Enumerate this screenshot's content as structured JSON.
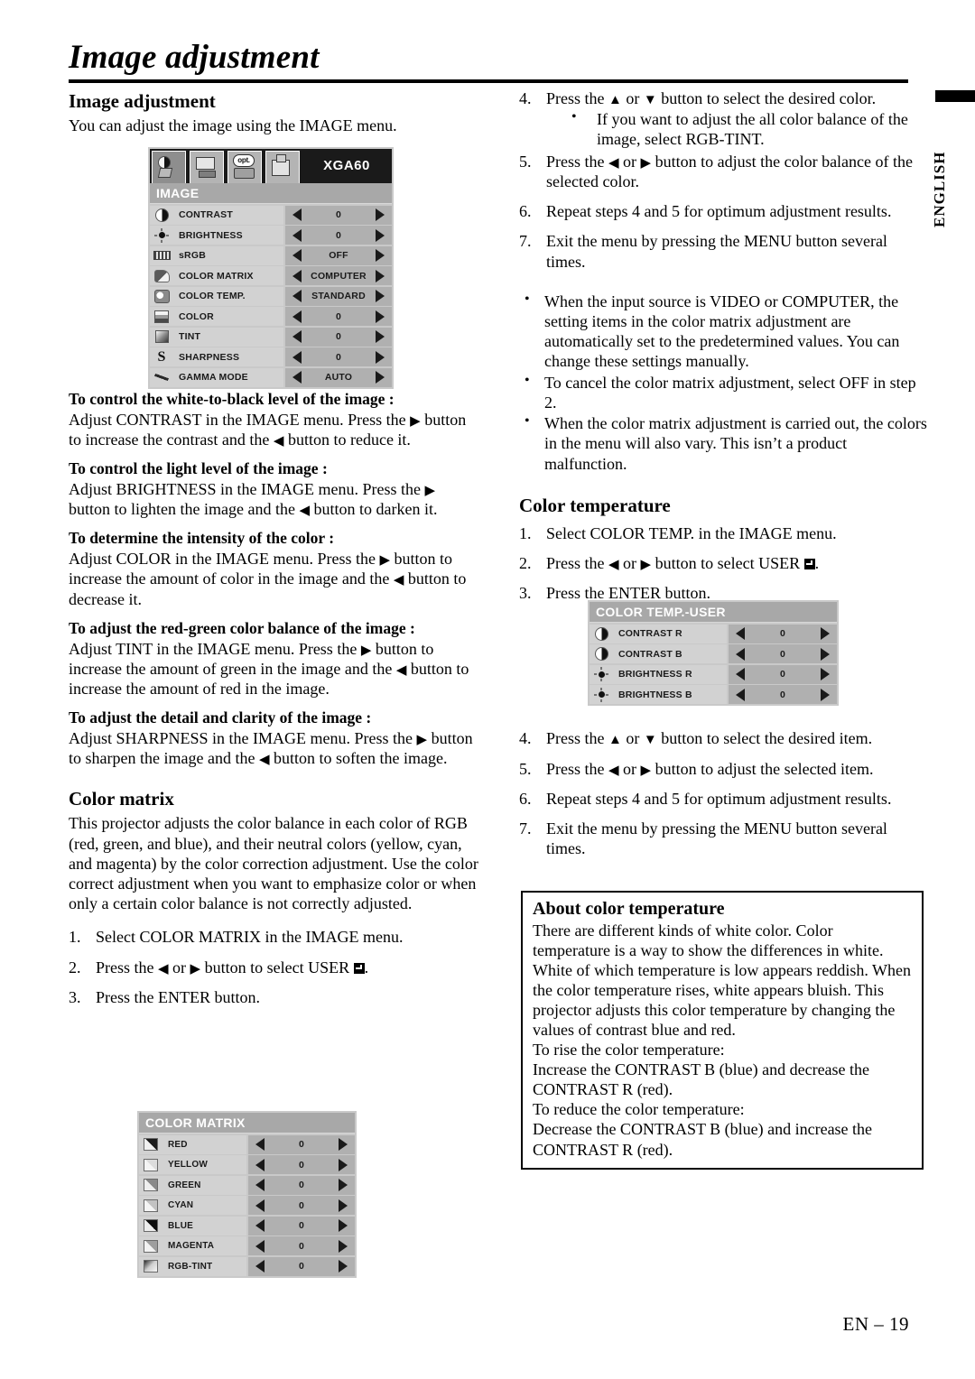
{
  "document": {
    "page_title": "Image adjustment",
    "side_tab_label": "ENGLISH",
    "footer": "EN – 19"
  },
  "left_column": {
    "section_heading": "Image adjustment",
    "intro": "You can adjust the image using the IMAGE menu.",
    "subsections": [
      {
        "heading": "To control the white-to-black level of the image :",
        "body_pre": "Adjust CONTRAST in the IMAGE menu.  Press the ",
        "body_mid": " button to increase the contrast and the ",
        "body_post": " button to reduce it."
      },
      {
        "heading": "To control the light level of the image :",
        "body_pre": "Adjust BRIGHTNESS in the IMAGE menu.  Press the ",
        "body_mid": " button to lighten the image and the ",
        "body_post": " button to darken it."
      },
      {
        "heading": "To determine the intensity of the color :",
        "body_pre": "Adjust COLOR in the IMAGE menu.  Press the ",
        "body_mid": " button to increase the amount of color in the image and the ",
        "body_post": " button to decrease it."
      },
      {
        "heading": "To adjust the red-green color balance of the image :",
        "body_pre": "Adjust TINT in the IMAGE menu.  Press the ",
        "body_mid": " button to increase the amount of green in the image and the ",
        "body_post": " button to increase the amount of red in the image."
      },
      {
        "heading": "To adjust the detail and clarity of the image :",
        "body_pre": "Adjust SHARPNESS in the IMAGE menu.  Press the ",
        "body_mid": " button to sharpen the image and the ",
        "body_post": " button to soften the image."
      }
    ],
    "color_matrix": {
      "heading": "Color matrix",
      "paragraph": "This projector adjusts the color balance in each color of RGB (red, green, and blue), and their neutral colors (yellow, cyan, and magenta) by the color correction adjustment. Use the color correct adjustment when you want to emphasize color or when only a certain color balance is not correctly adjusted.",
      "steps": [
        {
          "num": "1.",
          "pre": "Select COLOR MATRIX in the IMAGE menu.",
          "mid": "",
          "post": "",
          "has_arrows": false
        },
        {
          "num": "2.",
          "pre": "Press the ",
          "mid": " or ",
          "post": " button to select USER ",
          "has_arrows": true,
          "trailing": "."
        },
        {
          "num": "3.",
          "pre": "Press the ENTER button.",
          "mid": "",
          "post": "",
          "has_arrows": false
        }
      ]
    }
  },
  "right_column": {
    "color_matrix_steps": [
      {
        "num": "4.",
        "pre": "Press the ",
        "mid": " or ",
        "post": " button to select the desired color.",
        "arrows": "updown"
      },
      {
        "num": "5.",
        "pre": "Press the ",
        "mid": " or ",
        "post": " button to adjust the color balance of the selected color.",
        "arrows": "leftright"
      },
      {
        "num": "6.",
        "pre": "Repeat steps 4 and 5 for optimum adjustment results.",
        "mid": "",
        "post": "",
        "arrows": "none"
      },
      {
        "num": "7.",
        "pre": "Exit the menu by pressing the MENU button several times.",
        "mid": "",
        "post": "",
        "arrows": "none"
      }
    ],
    "color_matrix_substep": "If you want to adjust the all color balance of the image, select RGB-TINT.",
    "color_matrix_notes": [
      "When the input source is VIDEO or COMPUTER, the setting items in the color matrix adjustment are automatically set to the predetermined values. You can change these settings manually.",
      "To cancel the color matrix adjustment, select OFF in step 2.",
      "When the color matrix adjustment is carried out, the colors in the menu will also vary. This isn’t a product malfunction."
    ],
    "color_temperature": {
      "heading": "Color temperature",
      "steps_top": [
        {
          "num": "1.",
          "pre": "Select COLOR TEMP. in the IMAGE menu.",
          "mid": "",
          "post": "",
          "arrows": "none"
        },
        {
          "num": "2.",
          "pre": "Press the ",
          "mid": " or ",
          "post": " button to select USER ",
          "arrows": "leftright",
          "trailing": "."
        },
        {
          "num": "3.",
          "pre": "Press the ENTER button.",
          "mid": "",
          "post": "",
          "arrows": "none"
        }
      ],
      "steps_bottom": [
        {
          "num": "4.",
          "pre": "Press the ",
          "mid": " or ",
          "post": " button to select the desired item.",
          "arrows": "updown"
        },
        {
          "num": "5.",
          "pre": "Press the ",
          "mid": " or ",
          "post": " button to adjust the selected item.",
          "arrows": "leftright"
        },
        {
          "num": "6.",
          "pre": "Repeat steps 4 and 5 for optimum adjustment results.",
          "mid": "",
          "post": "",
          "arrows": "none"
        },
        {
          "num": "7.",
          "pre": "Exit the menu by pressing the MENU button several times.",
          "mid": "",
          "post": "",
          "arrows": "none"
        }
      ]
    },
    "about_box": {
      "heading": "About color temperature",
      "paragraph_1": "There are different kinds of white color. Color temperature is a way to show the differences in white. White of which temperature is low appears reddish. When the color temperature rises, white appears bluish. This projector adjusts this color temperature by changing the values of contrast blue and red.",
      "line_rise_label": "To rise the color temperature:",
      "line_rise_body": "Increase the CONTRAST B (blue) and decrease the CONTRAST R (red).",
      "line_reduce_label": "To reduce the color temperature:",
      "line_reduce_body": "Decrease the CONTRAST B (blue) and increase the CONTRAST R (red)."
    }
  },
  "osd_image_menu": {
    "source_label": "XGA60",
    "title": "IMAGE",
    "tabs": [
      {
        "icon": "image-tab-icon",
        "active": true
      },
      {
        "icon": "screen-tab-icon",
        "active": false
      },
      {
        "icon": "option-tab-icon",
        "active": false,
        "text": "opt."
      },
      {
        "icon": "feature-tab-icon",
        "active": false
      }
    ],
    "rows": [
      {
        "icon": "contrast-icon",
        "label": "CONTRAST",
        "value": "0"
      },
      {
        "icon": "brightness-icon",
        "label": "BRIGHTNESS",
        "value": "0"
      },
      {
        "icon": "srgb-icon",
        "label": "sRGB",
        "value": "OFF"
      },
      {
        "icon": "color-matrix-icon",
        "label": "COLOR MATRIX",
        "value": "COMPUTER"
      },
      {
        "icon": "color-temp-icon",
        "label": "COLOR TEMP.",
        "value": "STANDARD"
      },
      {
        "icon": "color-icon",
        "label": "COLOR",
        "value": "0"
      },
      {
        "icon": "tint-icon",
        "label": "TINT",
        "value": "0"
      },
      {
        "icon": "sharpness-icon",
        "label": "SHARPNESS",
        "value": "0"
      },
      {
        "icon": "gamma-mode-icon",
        "label": "GAMMA MODE",
        "value": "AUTO"
      }
    ]
  },
  "osd_color_matrix_menu": {
    "title": "COLOR MATRIX",
    "rows": [
      {
        "icon": "swatch-red-icon",
        "label": "RED",
        "value": "0"
      },
      {
        "icon": "swatch-yellow-icon",
        "label": "YELLOW",
        "value": "0"
      },
      {
        "icon": "swatch-green-icon",
        "label": "GREEN",
        "value": "0"
      },
      {
        "icon": "swatch-cyan-icon",
        "label": "CYAN",
        "value": "0"
      },
      {
        "icon": "swatch-blue-icon",
        "label": "BLUE",
        "value": "0"
      },
      {
        "icon": "swatch-magenta-icon",
        "label": "MAGENTA",
        "value": "0"
      },
      {
        "icon": "swatch-rgbtint-icon",
        "label": "RGB-TINT",
        "value": "0"
      }
    ]
  },
  "osd_color_temp_menu": {
    "title": "COLOR TEMP.-USER",
    "rows": [
      {
        "icon": "contrast-icon",
        "label": "CONTRAST R",
        "value": "0"
      },
      {
        "icon": "contrast-icon",
        "label": "CONTRAST B",
        "value": "0"
      },
      {
        "icon": "brightness-icon",
        "label": "BRIGHTNESS R",
        "value": "0"
      },
      {
        "icon": "brightness-icon",
        "label": "BRIGHTNESS B",
        "value": "0"
      }
    ]
  }
}
